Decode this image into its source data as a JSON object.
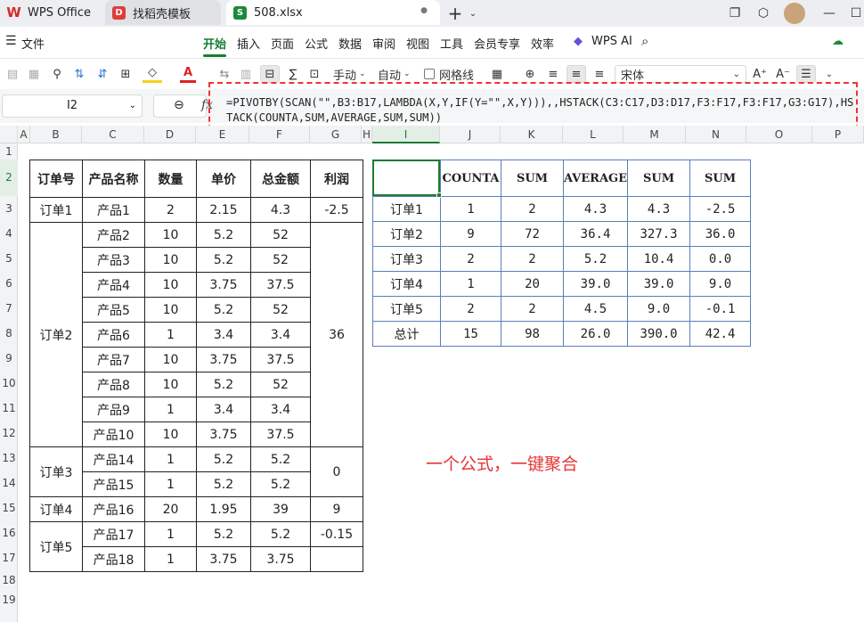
{
  "titlebar": {
    "tabs": [
      {
        "label": "WPS Office"
      },
      {
        "label": "找稻壳模板"
      },
      {
        "label": "508.xlsx"
      }
    ],
    "new_tab": "+"
  },
  "menubar": {
    "file": "文件",
    "items": [
      "开始",
      "插入",
      "页面",
      "公式",
      "数据",
      "审阅",
      "视图",
      "工具",
      "会员专享",
      "效率"
    ],
    "ai": "WPS AI"
  },
  "toolbar": {
    "manual": "手动",
    "auto": "自动",
    "gridlines": "网格线",
    "font": "宋体"
  },
  "formula_bar": {
    "cell_ref": "I2",
    "fx": "fx",
    "formula": "=PIVOTBY(SCAN(\"\",B3:B17,LAMBDA(X,Y,IF(Y=\"\",X,Y))),,HSTACK(C3:C17,D3:D17,F3:F17,F3:F17,G3:G17),HSTACK(COUNTA,SUM,AVERAGE,SUM,SUM))"
  },
  "columns": [
    "A",
    "B",
    "C",
    "D",
    "E",
    "F",
    "G",
    "H",
    "I",
    "J",
    "K",
    "L",
    "M",
    "N",
    "O",
    "P"
  ],
  "rows": [
    "1",
    "2",
    "3",
    "4",
    "5",
    "6",
    "7",
    "8",
    "9",
    "10",
    "11",
    "12",
    "13",
    "14",
    "15",
    "16",
    "17",
    "18",
    "19"
  ],
  "left_table": {
    "headers": [
      "订单号",
      "产品名称",
      "数量",
      "单价",
      "总金额",
      "利润"
    ],
    "orders": [
      "订单1",
      "订单2",
      "订单3",
      "订单4",
      "订单5"
    ],
    "products": [
      "产品1",
      "产品2",
      "产品3",
      "产品4",
      "产品5",
      "产品6",
      "产品7",
      "产品8",
      "产品9",
      "产品10",
      "产品14",
      "产品15",
      "产品16",
      "产品17",
      "产品18"
    ],
    "qty": [
      "2",
      "10",
      "10",
      "10",
      "10",
      "1",
      "10",
      "10",
      "1",
      "10",
      "1",
      "1",
      "20",
      "1",
      "1"
    ],
    "price": [
      "2.15",
      "5.2",
      "5.2",
      "3.75",
      "5.2",
      "3.4",
      "3.75",
      "5.2",
      "3.4",
      "3.75",
      "5.2",
      "5.2",
      "1.95",
      "5.2",
      "3.75"
    ],
    "amount": [
      "4.3",
      "52",
      "52",
      "37.5",
      "52",
      "3.4",
      "37.5",
      "52",
      "3.4",
      "37.5",
      "5.2",
      "5.2",
      "39",
      "5.2",
      "3.75"
    ],
    "profit": [
      "-2.5",
      "36",
      "0",
      "9",
      "-0.15",
      ""
    ]
  },
  "right_table": {
    "headers": [
      "",
      "COUNTA",
      "SUM",
      "AVERAGE",
      "SUM",
      "SUM"
    ],
    "rows": [
      [
        "订单1",
        "1",
        "2",
        "4.3",
        "4.3",
        "-2.5"
      ],
      [
        "订单2",
        "9",
        "72",
        "36.4",
        "327.3",
        "36.0"
      ],
      [
        "订单3",
        "2",
        "2",
        "5.2",
        "10.4",
        "0.0"
      ],
      [
        "订单4",
        "1",
        "20",
        "39.0",
        "39.0",
        "9.0"
      ],
      [
        "订单5",
        "2",
        "2",
        "4.5",
        "9.0",
        "-0.1"
      ],
      [
        "总计",
        "15",
        "98",
        "26.0",
        "390.0",
        "42.4"
      ]
    ]
  },
  "caption": "一个公式，一键聚合",
  "colors": {
    "accent": "#157f35",
    "annotation": "#e53535",
    "table_border": "#5b7fb5"
  }
}
